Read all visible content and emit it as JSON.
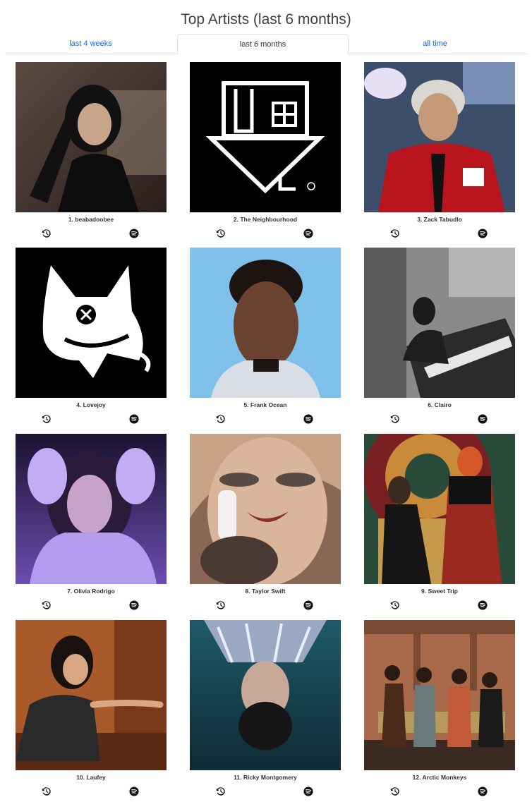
{
  "page": {
    "title": "Top Artists (last 6 months)"
  },
  "tabs": [
    {
      "label": "last 4 weeks",
      "active": false
    },
    {
      "label": "last 6 months",
      "active": true
    },
    {
      "label": "all time",
      "active": false
    }
  ],
  "artists": [
    {
      "label": "1. beabadoobee"
    },
    {
      "label": "2. The Neighbourhood"
    },
    {
      "label": "3. Zack Tabudlo"
    },
    {
      "label": "4. Lovejoy"
    },
    {
      "label": "5. Frank Ocean"
    },
    {
      "label": "6. Clairo"
    },
    {
      "label": "7. Olivia Rodrigo"
    },
    {
      "label": "8. Taylor Swift"
    },
    {
      "label": "9. Sweet Trip"
    },
    {
      "label": "10. Laufey"
    },
    {
      "label": "11. Ricky Montgomery"
    },
    {
      "label": "12. Arctic Monkeys"
    }
  ],
  "icons": {
    "history": "history-icon",
    "spotify": "spotify-icon"
  },
  "colors": {
    "link": "#0d6efd",
    "tab_border": "#dee2e6",
    "icon": "#111111"
  }
}
